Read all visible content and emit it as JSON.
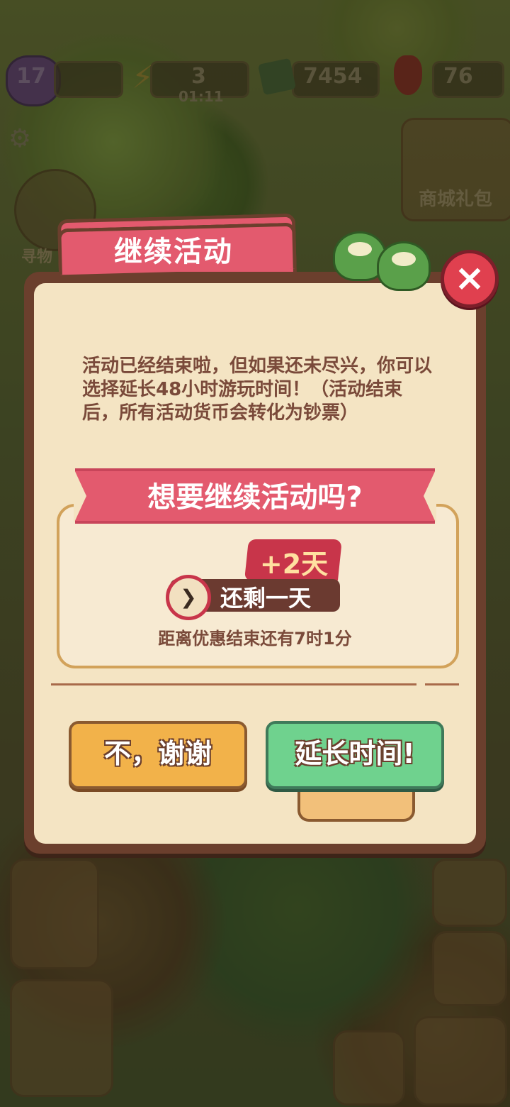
{
  "hud": {
    "level": "17",
    "energy": "3",
    "energy_timer": "01:11",
    "cash": "7454",
    "gems": "76"
  },
  "side": {
    "find_label": "寻物",
    "shop_label": "商城礼包"
  },
  "modal": {
    "tab_title": "继续活动",
    "description": "活动已经结束啦，但如果还未尽兴，你可以选择延长48小时游玩时间！（活动结束后，所有活动货币会转化为钞票）",
    "question": "想要继续活动吗?",
    "bonus": "+2天",
    "remaining": "还剩一天",
    "promo_countdown": "距离优惠结束还有7时1分",
    "decline_label": "不，谢谢",
    "extend_label": "延长时间!"
  },
  "icons": {
    "close": "close-icon",
    "settings": "gear-icon",
    "timer": "timer-icon"
  },
  "colors": {
    "accent_red": "#e35a6e",
    "panel_bg": "#f4e4c3",
    "frame_brown": "#6b3f2d",
    "decline_orange": "#f2b24a",
    "extend_green": "#6fd28e"
  }
}
